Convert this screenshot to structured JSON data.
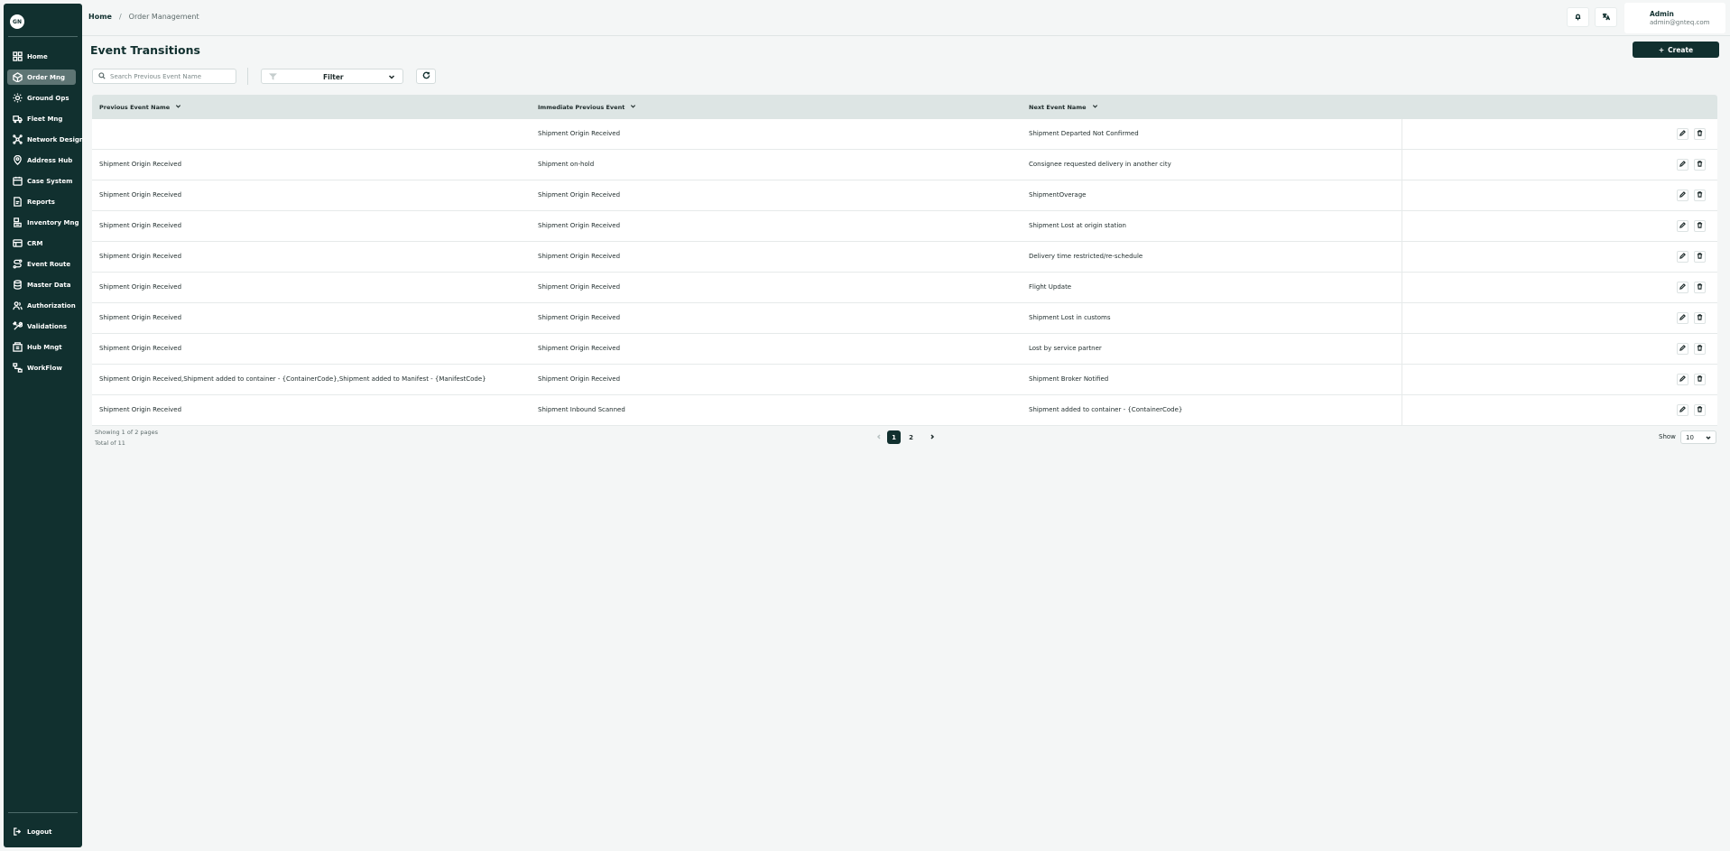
{
  "brand": {
    "logo_text": "GN"
  },
  "sidebar": {
    "items": [
      {
        "label": "Home",
        "icon": "grid-icon",
        "active": false
      },
      {
        "label": "Order Mng",
        "icon": "package-icon",
        "active": true
      },
      {
        "label": "Ground Ops",
        "icon": "sun-icon",
        "active": false
      },
      {
        "label": "Fleet Mng",
        "icon": "truck-icon",
        "active": false
      },
      {
        "label": "Network Design",
        "icon": "network-icon",
        "active": false
      },
      {
        "label": "Address Hub",
        "icon": "location-icon",
        "active": false
      },
      {
        "label": "Case System",
        "icon": "case-icon",
        "active": false
      },
      {
        "label": "Reports",
        "icon": "report-icon",
        "active": false
      },
      {
        "label": "Inventory Mng",
        "icon": "inventory-icon",
        "active": false
      },
      {
        "label": "CRM",
        "icon": "crm-icon",
        "active": false
      },
      {
        "label": "Event Route",
        "icon": "route-icon",
        "active": false
      },
      {
        "label": "Master Data",
        "icon": "database-icon",
        "active": false
      },
      {
        "label": "Authorization",
        "icon": "users-icon",
        "active": false
      },
      {
        "label": "Validations",
        "icon": "tools-icon",
        "active": false
      },
      {
        "label": "Hub Mngt",
        "icon": "hub-icon",
        "active": false
      },
      {
        "label": "WorkFlow",
        "icon": "workflow-icon",
        "active": false
      }
    ],
    "logout_label": "Logout"
  },
  "header": {
    "breadcrumb_home": "Home",
    "breadcrumb_sep": "/",
    "breadcrumb_current": "Order Management",
    "user_name": "Admin",
    "user_email": "admin@gnteq.com"
  },
  "main": {
    "title": "Event Transitions",
    "create_label": "Create",
    "search_placeholder": "Search Previous Event Name",
    "filter_label": "Filter"
  },
  "table": {
    "columns": [
      "Previous Event Name",
      "Immediate Previous Event",
      "Next Event Name"
    ],
    "rows": [
      [
        "",
        "Shipment Origin Received",
        "Shipment Departed Not Confirmed"
      ],
      [
        "Shipment Origin Received",
        "Shipment on-hold",
        "Consignee requested delivery in another city"
      ],
      [
        "Shipment Origin Received",
        "Shipment Origin Received",
        "ShipmentOverage"
      ],
      [
        "Shipment Origin Received",
        "Shipment Origin Received",
        "Shipment Lost at origin station"
      ],
      [
        "Shipment Origin Received",
        "Shipment Origin Received",
        "Delivery time restricted/re-schedule"
      ],
      [
        "Shipment Origin Received",
        "Shipment Origin Received",
        "Flight Update"
      ],
      [
        "Shipment Origin Received",
        "Shipment Origin Received",
        "Shipment Lost in customs"
      ],
      [
        "Shipment Origin Received",
        "Shipment Origin Received",
        "Lost by service partner"
      ],
      [
        "Shipment Origin Received,Shipment added to container - {ContainerCode},Shipment added to Manifest - {ManifestCode}",
        "Shipment Origin Received",
        "Shipment Broker Notified"
      ],
      [
        "Shipment Origin Received",
        "Shipment Inbound Scanned",
        "Shipment added to container - {ContainerCode}"
      ]
    ]
  },
  "pagination": {
    "showing_text": "Showing 1 of 2 pages",
    "total_text": "Total of 11",
    "pages": [
      "1",
      "2"
    ],
    "current_page": "1",
    "show_label": "Show",
    "page_size": "10"
  },
  "colors": {
    "sidebar_bg": "#11302f",
    "accent": "#11302f",
    "active_item": "#5e7574",
    "table_header": "#dde5e4"
  }
}
